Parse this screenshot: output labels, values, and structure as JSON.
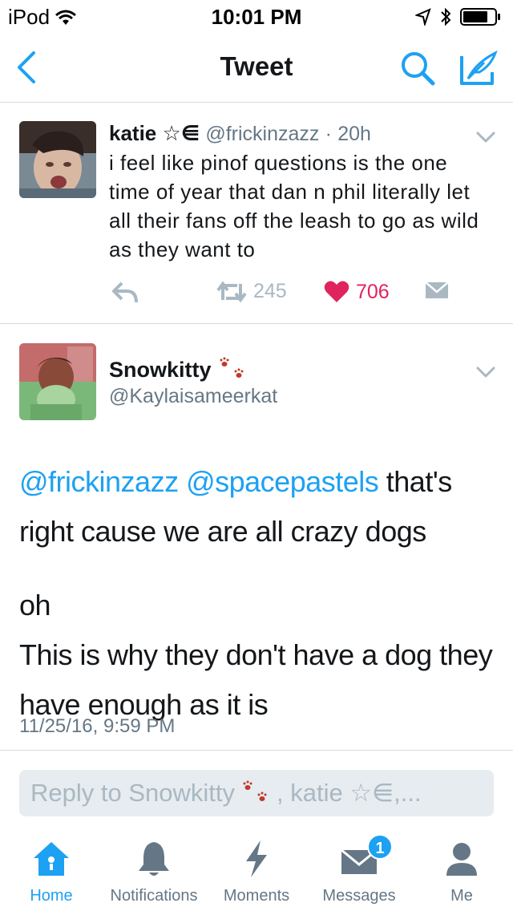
{
  "status_bar": {
    "carrier": "iPod",
    "time": "10:01 PM"
  },
  "nav": {
    "title": "Tweet"
  },
  "tweet1": {
    "name": "katie ☆⋹",
    "handle": "@frickinzazz",
    "separator": "·",
    "age": "20h",
    "text": "i feel like pinof questions is the one time of year that dan n phil literally let all their fans off the leash to go as wild as they want to",
    "retweets": "245",
    "likes": "706"
  },
  "tweet2": {
    "name": "Snowkitty",
    "handle": "@Kaylaisameerkat",
    "mention1": "@frickinzazz",
    "mention2": "@spacepastels",
    "text_after_mentions": " that's right cause we are all crazy dogs",
    "line2": "oh",
    "line3": "This is why they don't have a dog they have enough as it is",
    "timestamp": "11/25/16, 9:59 PM"
  },
  "reply": {
    "placeholder_start": "Reply to Snowkitty",
    "placeholder_end": ", katie ☆⋹,..."
  },
  "tabs": [
    {
      "label": "Home",
      "icon": "home-icon",
      "active": true
    },
    {
      "label": "Notifications",
      "icon": "bell-icon",
      "active": false
    },
    {
      "label": "Moments",
      "icon": "lightning-icon",
      "active": false
    },
    {
      "label": "Messages",
      "icon": "envelope-icon",
      "active": false,
      "badge": "1"
    },
    {
      "label": "Me",
      "icon": "person-icon",
      "active": false
    }
  ],
  "colors": {
    "accent": "#1da1f2",
    "like": "#e0245e",
    "text": "#14171a",
    "secondary": "#657786",
    "paw": "#c0392b"
  }
}
